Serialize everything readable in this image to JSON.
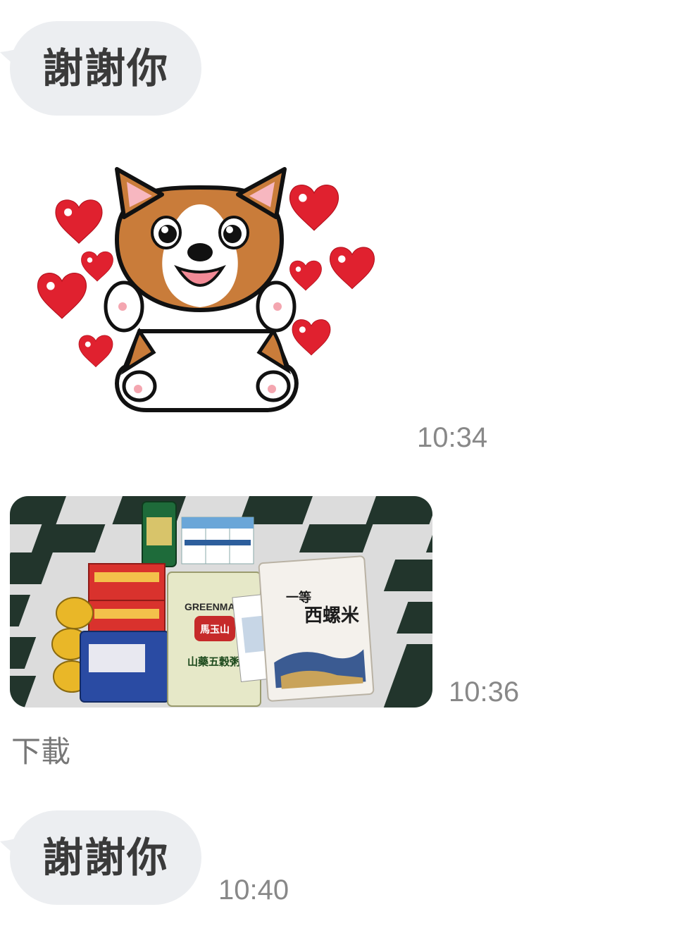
{
  "messages": [
    {
      "type": "text",
      "text": "謝謝你"
    },
    {
      "type": "sticker",
      "sticker_icon": "corgi-hearts-sticker",
      "time": "10:34"
    },
    {
      "type": "image",
      "image_icon": "photo-of-gift-items",
      "time": "10:36",
      "action_label": "下載",
      "product_labels": {
        "brand": "GREENMAX",
        "cereal_brand": "馬玉山",
        "cereal_name": "山藥五穀粥",
        "rice_grade": "一等",
        "rice_name": "西螺米"
      }
    },
    {
      "type": "text",
      "text": "謝謝你",
      "time": "10:40"
    }
  ],
  "colors": {
    "bubble_bg": "#eceef1",
    "bubble_text": "#3a3a3a",
    "timestamp": "#888888",
    "heart": "#e0212f",
    "corgi_tan": "#c97c3a"
  }
}
